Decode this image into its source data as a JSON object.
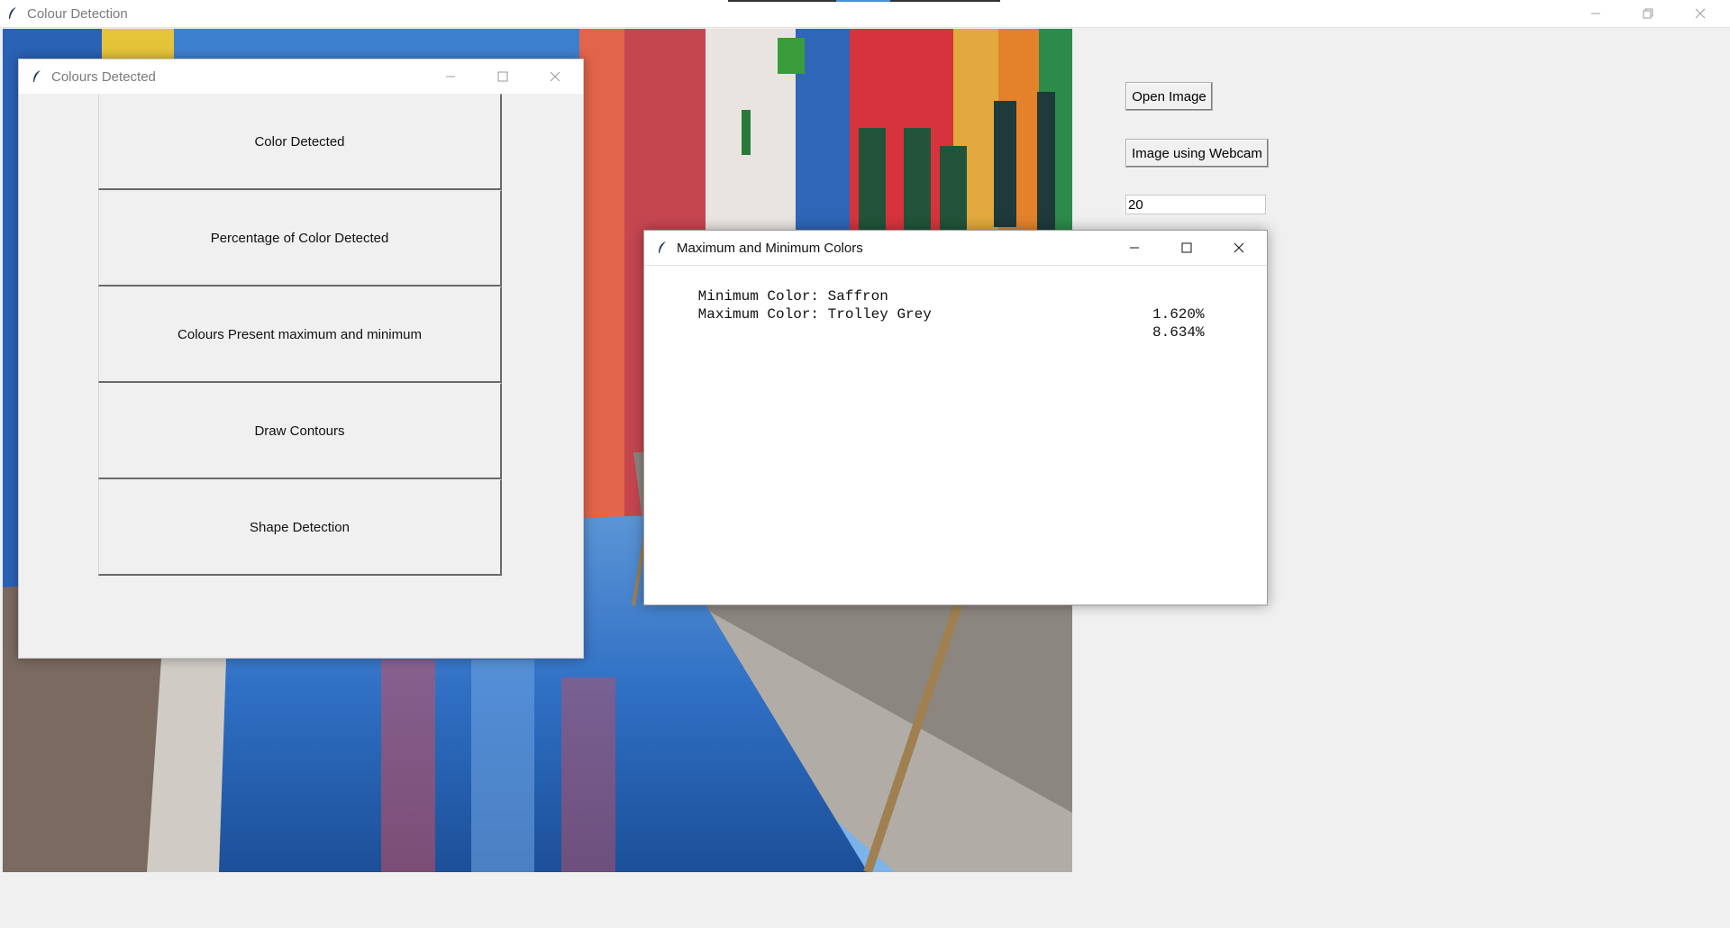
{
  "main_window": {
    "title": "Colour Detection",
    "open_image_label": "Open Image",
    "webcam_label": "Image using Webcam",
    "threshold_value": "20"
  },
  "colours_window": {
    "title": "Colours Detected",
    "buttons": [
      {
        "label": "Color Detected"
      },
      {
        "label": "Percentage of Color Detected"
      },
      {
        "label": "Colours Present maximum and minimum"
      },
      {
        "label": "Draw Contours"
      },
      {
        "label": "Shape Detection"
      }
    ]
  },
  "maxmin_window": {
    "title": "Maximum and Minimum Colors",
    "rows": [
      {
        "label": "Minimum Color: Saffron",
        "percentage": "1.620%"
      },
      {
        "label": "Maximum Color: Trolley Grey",
        "percentage": "8.634%"
      }
    ]
  },
  "colors": {
    "titlebar_bg": "#ffffff",
    "window_bg": "#f0f0f0",
    "button_shadow": "#696969"
  }
}
